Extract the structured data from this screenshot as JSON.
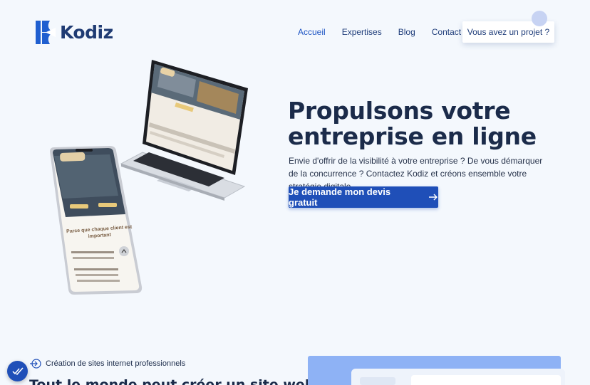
{
  "brand": {
    "name": "Kodiz",
    "logo_icon": "kodiz-logo-mark",
    "accent": "#1f4fb8"
  },
  "nav": {
    "items": [
      {
        "label": "Accueil",
        "active": true
      },
      {
        "label": "Expertises"
      },
      {
        "label": "Blog"
      },
      {
        "label": "Contact"
      }
    ],
    "cta": "Vous avez un projet ?"
  },
  "hero": {
    "title_line1": "Propulsons votre",
    "title_line2": "entreprise en ligne",
    "subtitle": "Envie d'offrir de la visibilité à votre entreprise ? De vous démarquer de la concurrence ? Contactez Kodiz et créons ensemble votre stratégie digitale",
    "button_label": "Je demande mon devis gratuit",
    "button_icon": "arrow-right-icon"
  },
  "mockup": {
    "phone_title": "Parce que chaque client est important"
  },
  "section": {
    "eyebrow": "Création de sites internet professionnels",
    "title": "Tout le monde peut créer un site web. En"
  },
  "colors": {
    "background": "#f4f8fd",
    "heading": "#1b2b4a",
    "panel": "#8eb2f5"
  }
}
